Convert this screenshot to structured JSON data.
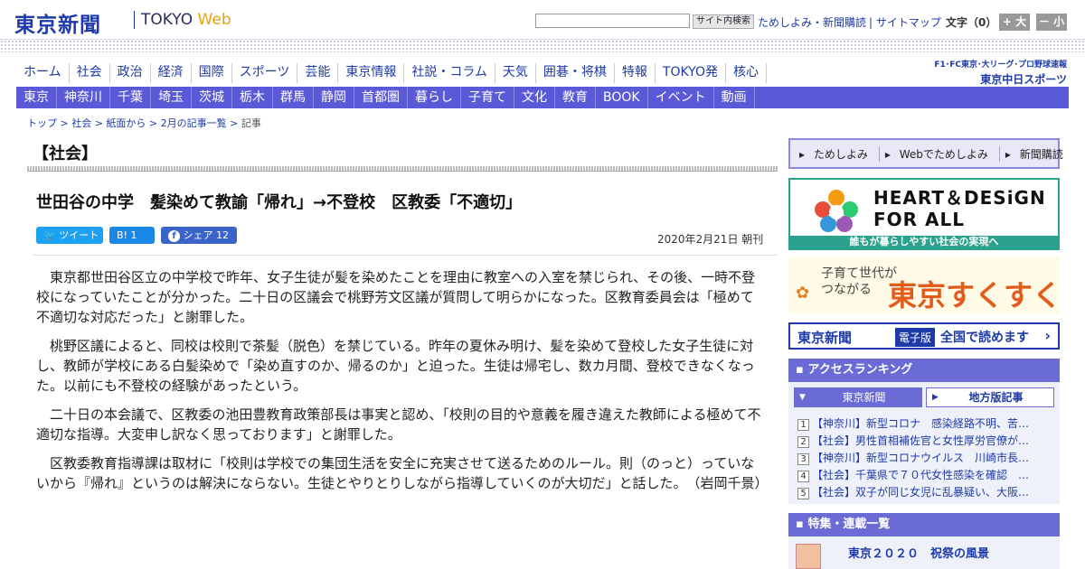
{
  "header": {
    "logo_jp": "東京新聞",
    "logo_en_prefix": "TOKYO ",
    "logo_en_suffix": "Web",
    "search_button": "サイト内検索",
    "links": [
      "ためしよみ・新聞購読",
      "サイトマップ"
    ],
    "font_size_label": "文字（0）",
    "font_plus": "+ 大",
    "font_minus": "－ 小"
  },
  "nav_main": [
    "ホーム",
    "社会",
    "政治",
    "経済",
    "国際",
    "スポーツ",
    "芸能",
    "東京情報",
    "社説・コラム",
    "天気",
    "囲碁・将棋",
    "特報",
    "TOKYO発",
    "核心"
  ],
  "chunichi": {
    "line1": "F1･FC東京･大リーグ･プロ野球速報",
    "line2": "東京中日スポーツ"
  },
  "nav_region": [
    "東京",
    "神奈川",
    "千葉",
    "埼玉",
    "茨城",
    "栃木",
    "群馬",
    "静岡",
    "首都圏",
    "暮らし",
    "子育て",
    "文化",
    "教育",
    "BOOK",
    "イベント",
    "動画"
  ],
  "breadcrumb": [
    "トップ",
    "社会",
    "紙面から",
    "2月の記事一覧",
    "記事"
  ],
  "article": {
    "section": "【社会】",
    "headline": "世田谷の中学　髪染めて教諭「帰れ」→不登校　区教委「不適切」",
    "share_tweet": "ツイート",
    "share_hatena": "B! 1",
    "share_facebook": "シェア 12",
    "date": "2020年2月21日 朝刊",
    "paragraphs": [
      "東京都世田谷区立の中学校で昨年、女子生徒が髪を染めたことを理由に教室への入室を禁じられ、その後、一時不登校になっていたことが分かった。二十日の区議会で桃野芳文区議が質問して明らかになった。区教育委員会は「極めて不適切な対応だった」と謝罪した。",
      "桃野区議によると、同校は校則で茶髪（脱色）を禁じている。昨年の夏休み明け、髪を染めて登校した女子生徒に対し、教師が学校にある白髪染めで「染め直すのか、帰るのか」と迫った。生徒は帰宅し、数カ月間、登校できなくなった。以前にも不登校の経験があったという。",
      "二十日の本会議で、区教委の池田豊教育政策部長は事実と認め、「校則の目的や意義を履き違えた教師による極めて不適切な指導。大変申し訳なく思っております」と謝罪した。",
      "区教委教育指導課は取材に「校則は学校での集団生活を安全に充実させて送るためのルール。則（のっと）っていないから『帰れ』というのは解決にならない。生徒とやりとりしながら指導していくのが大切だ」と話した。　（岩岡千景）"
    ]
  },
  "sidebar": {
    "tameshi": [
      "ためしよみ",
      "Webでためしよみ",
      "新聞購読"
    ],
    "heart_title_1": "HEART＆DESiGN",
    "heart_title_2": "FOR ALL",
    "heart_caption": "誰もが暮らしやすい社会の実現へ",
    "sukusuku_a1": "子育て世代が",
    "sukusuku_a2": "つながる",
    "sukusuku_b": "東京すくすく",
    "denshi_1": "東京新聞",
    "denshi_2": "電子版",
    "denshi_3": "全国で読めます",
    "ranking_title": "アクセスランキング",
    "ranking_tab1": "東京新聞",
    "ranking_tab2": "地方版記事",
    "ranking_items": [
      "【神奈川】新型コロナ　感染経路不明、苦…",
      "【社会】男性首相補佐官と女性厚労官僚が…",
      "【神奈川】新型コロナウイルス　川崎市長…",
      "【社会】千葉県で７０代女性感染を確認　…",
      "【社会】双子が同じ女児に乱暴疑い、大阪…"
    ],
    "tokushu_title": "特集・連載一覧",
    "tokushu_item": "東京２０２０　祝祭の風景"
  }
}
